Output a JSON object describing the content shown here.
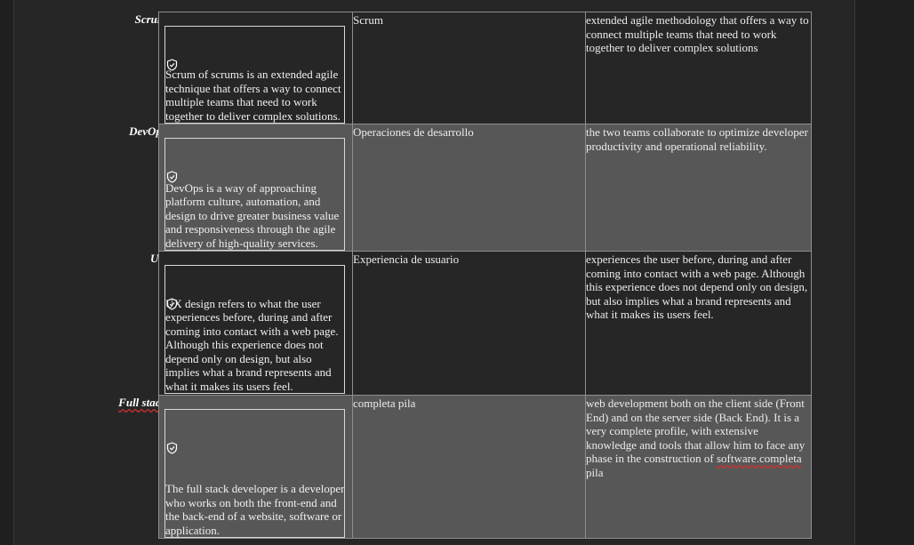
{
  "rows": [
    {
      "term": "Scrum",
      "box_text": "Scrum of scrums is an extended agile technique that offers a way to connect multiple teams that need to work together to deliver complex solutions.",
      "translation": "Scrum",
      "definition": "extended agile methodology that offers a way to connect multiple teams that need to work together to deliver complex solutions"
    },
    {
      "term": "DevOps",
      "box_text": "DevOps is a way of approaching platform culture, automation, and design to drive greater business value and responsiveness through the agile delivery of high-quality services.",
      "translation": "Operaciones de desarrollo",
      "definition": "the two teams collaborate to optimize developer productivity and operational reliability."
    },
    {
      "term": "UX",
      "box_text": "UX design refers to what the user experiences before, during and after coming into contact with a web page. Although this experience does not depend only on design, but also implies what a brand represents and what it makes its users feel.",
      "translation": "Experiencia de usuario",
      "definition": "experiences the user before, during and after coming into contact with a web page. Although this experience does not depend only on design, but also implies what a brand represents and what it makes its users feel."
    },
    {
      "term": "Full stack",
      "box_text": "The full stack developer is a developer who works on both the front-end and the back-end of a website, software or application.",
      "translation": "completa pila",
      "definition_main": "web development both on the client side (Front End) and on the server side (Back End). It is a very complete profile, with extensive knowledge and tools that allow him to face any phase in the construction of ",
      "definition_flagged": "software.completa",
      "definition_tail": " pila"
    }
  ],
  "icon": "shield-check-icon"
}
